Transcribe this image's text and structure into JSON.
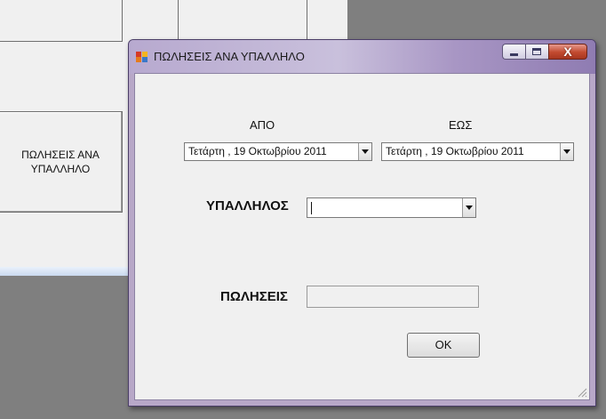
{
  "main_form": {
    "sales_by_employee_button": "ΠΩΛΗΣΕΙΣ ΑΝΑ\nΥΠΑΛΛΗΛΟ"
  },
  "dialog": {
    "title": "ΠΩΛΗΣΕΙΣ ΑΝΑ ΥΠΑΛΛΗΛΟ",
    "caption_close": "X",
    "from_label": "ΑΠΟ",
    "to_label": "ΕΩΣ",
    "from_date": "Τετάρτη , 19  Οκτωβρίου  2011",
    "to_date": "Τετάρτη , 19  Οκτωβρίου  2011",
    "employee_label": "ΥΠΑΛΛΗΛΟΣ",
    "employee_value": "",
    "sales_label": "ΠΩΛΗΣΕΙΣ",
    "sales_value": "",
    "ok_label": "OK"
  }
}
